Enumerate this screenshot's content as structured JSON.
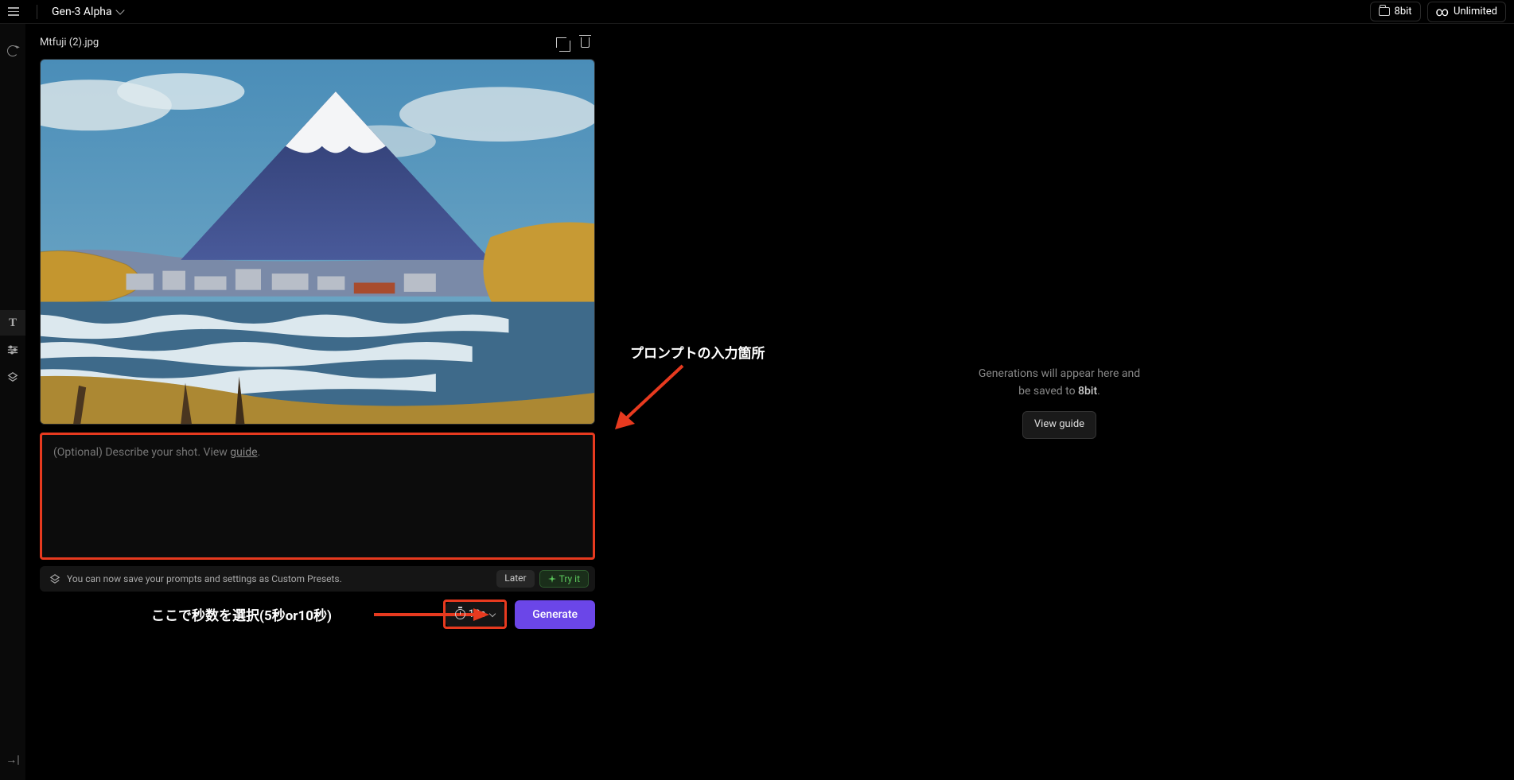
{
  "topbar": {
    "model_name": "Gen-3 Alpha",
    "folder_label": "8bit",
    "plan_label": "Unlimited"
  },
  "file": {
    "name": "Mtfuji (2).jpg"
  },
  "prompt": {
    "placeholder_prefix": "(Optional) Describe your shot. View ",
    "guide_word": "guide",
    "placeholder_suffix": "."
  },
  "tip": {
    "text": "You can now save your prompts and settings as Custom Presets.",
    "later": "Later",
    "tryit": "Try it"
  },
  "controls": {
    "duration": "10s",
    "generate": "Generate"
  },
  "preview": {
    "line1_a": "Generations will appear here and",
    "line2_a": "be saved to ",
    "line2_b": "8bit",
    "line2_c": ".",
    "view_guide": "View guide"
  },
  "annotations": {
    "prompt_label": "プロンプトの入力箇所",
    "duration_label": "ここで秒数を選択(5秒or10秒)"
  }
}
